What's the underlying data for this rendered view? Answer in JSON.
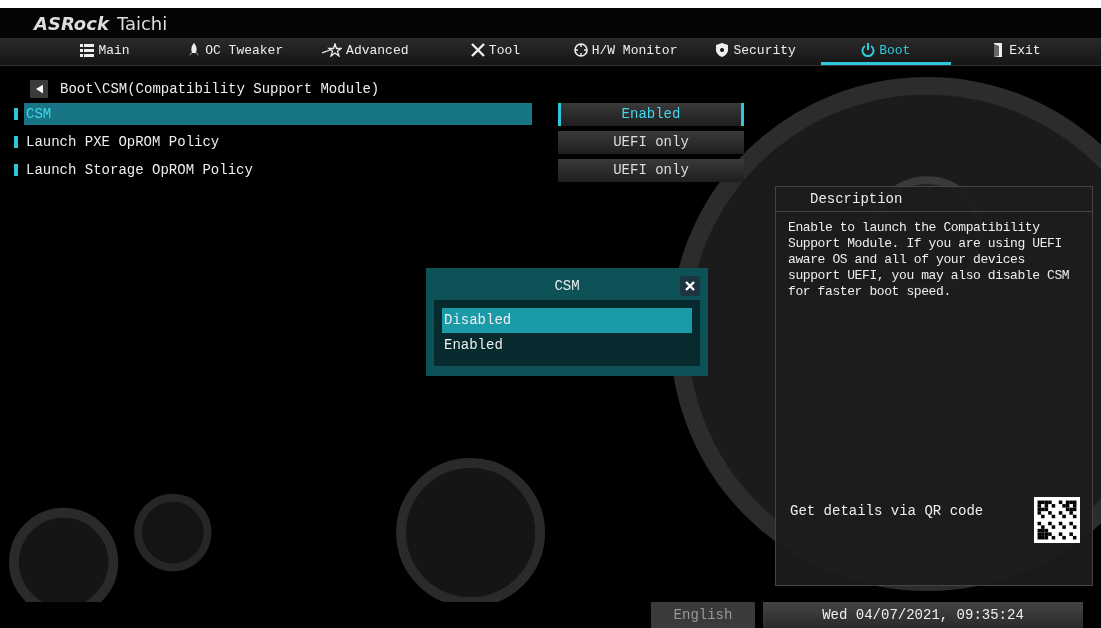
{
  "header": {
    "brand": "ASRock",
    "product": "Taichi"
  },
  "tabs": [
    {
      "label": "Main",
      "selected": false
    },
    {
      "label": "OC Tweaker",
      "selected": false
    },
    {
      "label": "Advanced",
      "selected": false
    },
    {
      "label": "Tool",
      "selected": false
    },
    {
      "label": "H/W Monitor",
      "selected": false
    },
    {
      "label": "Security",
      "selected": false
    },
    {
      "label": "Boot",
      "selected": true
    },
    {
      "label": "Exit",
      "selected": false
    }
  ],
  "breadcrumb": "Boot\\CSM(Compatibility Support Module)",
  "settings": [
    {
      "label": "CSM",
      "value": "Enabled",
      "selected": true
    },
    {
      "label": "Launch PXE OpROM Policy",
      "value": "UEFI only",
      "selected": false
    },
    {
      "label": "Launch Storage OpROM Policy",
      "value": "UEFI only",
      "selected": false
    }
  ],
  "popup": {
    "title": "CSM",
    "options": [
      {
        "label": "Disabled",
        "selected": true
      },
      {
        "label": "Enabled",
        "selected": false
      }
    ]
  },
  "description": {
    "title": "Description",
    "text": "Enable to launch the Compatibility Support Module. If you are using UEFI aware OS and all of your devices support UEFI, you may also disable CSM for faster boot speed.",
    "qr_label": "Get details via QR code"
  },
  "status_bar": {
    "language": "English",
    "datetime": "Wed 04/07/2021, 09:35:24"
  }
}
